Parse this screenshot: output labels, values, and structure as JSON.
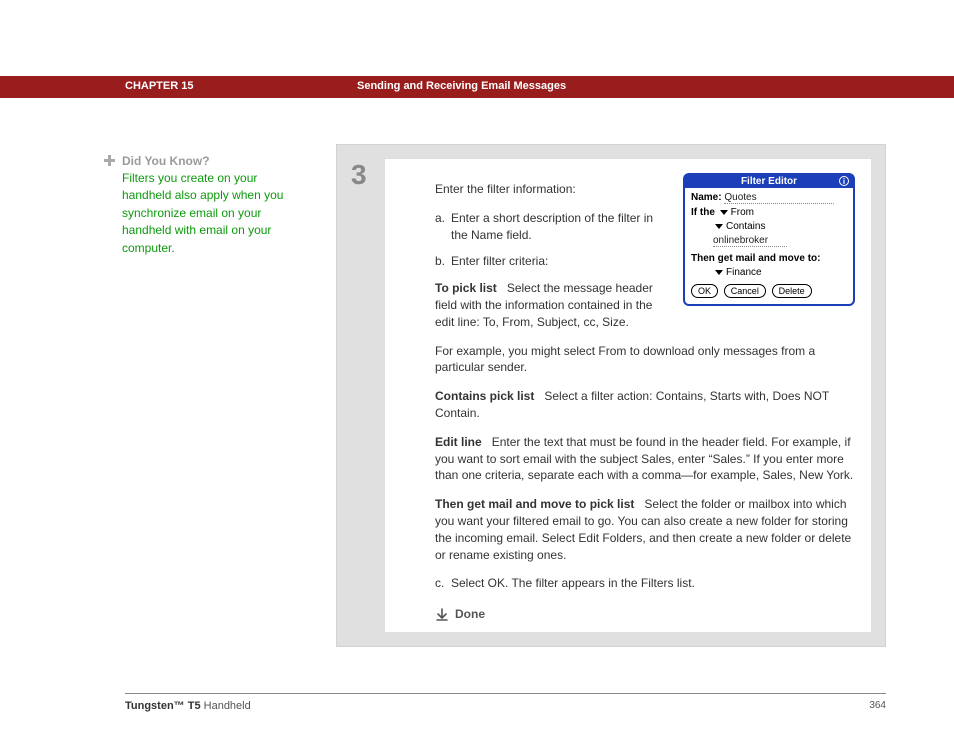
{
  "header": {
    "chapter": "CHAPTER 15",
    "title": "Sending and Receiving Email Messages"
  },
  "sidebar": {
    "heading": "Did You Know?",
    "body": "Filters you create on your handheld also apply when you synchronize email on your handheld with email on your computer."
  },
  "step": {
    "number": "3",
    "intro": "Enter the filter information:",
    "a": "Enter a short description of the filter in the Name field.",
    "b": "Enter filter criteria:",
    "to_pick_label": "To pick list",
    "to_pick_text_1": "Select the message header field with the information contained in the edit line: To, From, Subject, cc, Size.",
    "to_pick_text_2": "For example, you might select From to download only messages from a particular sender.",
    "contains_label": "Contains pick list",
    "contains_text": "Select a filter action: Contains, Starts with, Does NOT Contain.",
    "edit_label": "Edit line",
    "edit_text": "Enter the text that must be found in the header field. For example, if you want to sort email with the subject Sales, enter “Sales.” If you enter more than one criteria, separate each with a comma—for example, Sales, New York.",
    "then_label": "Then get mail and move to pick list",
    "then_text": "Select the folder or mailbox into which you want your filtered email to go. You can also create a new folder for storing the incoming email. Select Edit Folders, and then create a new folder or delete or rename existing ones.",
    "c": "Select OK. The filter appears in the Filters list.",
    "done": "Done"
  },
  "filter_editor": {
    "title": "Filter Editor",
    "name_label": "Name:",
    "name_value": "Quotes",
    "if_label": "If the",
    "from": "From",
    "contains": "Contains",
    "value": "onlinebroker",
    "then_label": "Then get mail and move to:",
    "target": "Finance",
    "btn_ok": "OK",
    "btn_cancel": "Cancel",
    "btn_delete": "Delete"
  },
  "footer": {
    "product_bold": "Tungsten™ T5",
    "product_rest": " Handheld",
    "page": "364"
  }
}
